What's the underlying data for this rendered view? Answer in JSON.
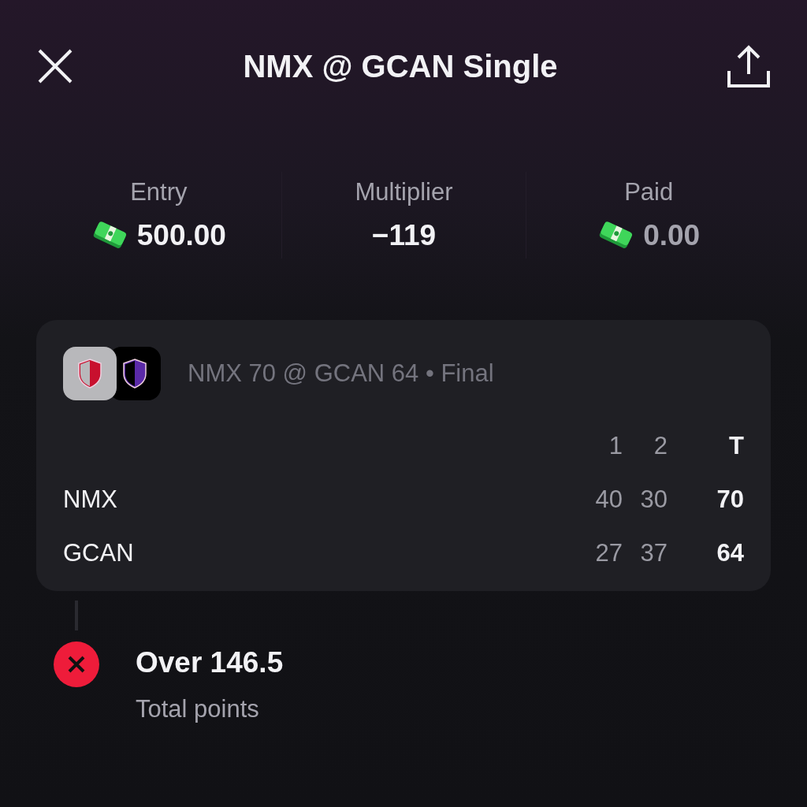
{
  "header": {
    "title": "NMX @ GCAN Single"
  },
  "stats": [
    {
      "label": "Entry",
      "value": "500.00",
      "kind": "money",
      "dim": false
    },
    {
      "label": "Multiplier",
      "value": "−119",
      "kind": "plain",
      "dim": false
    },
    {
      "label": "Paid",
      "value": "0.00",
      "kind": "money",
      "dim": true
    }
  ],
  "game": {
    "summary": "NMX 70 @ GCAN 64 • Final",
    "teams": [
      {
        "color": "#c8102e",
        "kind": "light"
      },
      {
        "color": "#5b2aa8",
        "kind": "dark"
      }
    ],
    "columns": [
      "1",
      "2",
      "T"
    ],
    "rows": [
      {
        "team": "NMX",
        "periods": [
          "40",
          "30"
        ],
        "total": "70"
      },
      {
        "team": "GCAN",
        "periods": [
          "27",
          "37"
        ],
        "total": "64"
      }
    ]
  },
  "legs": [
    {
      "pick": "Over 146.5",
      "market": "Total points",
      "kind": "lost"
    }
  ]
}
